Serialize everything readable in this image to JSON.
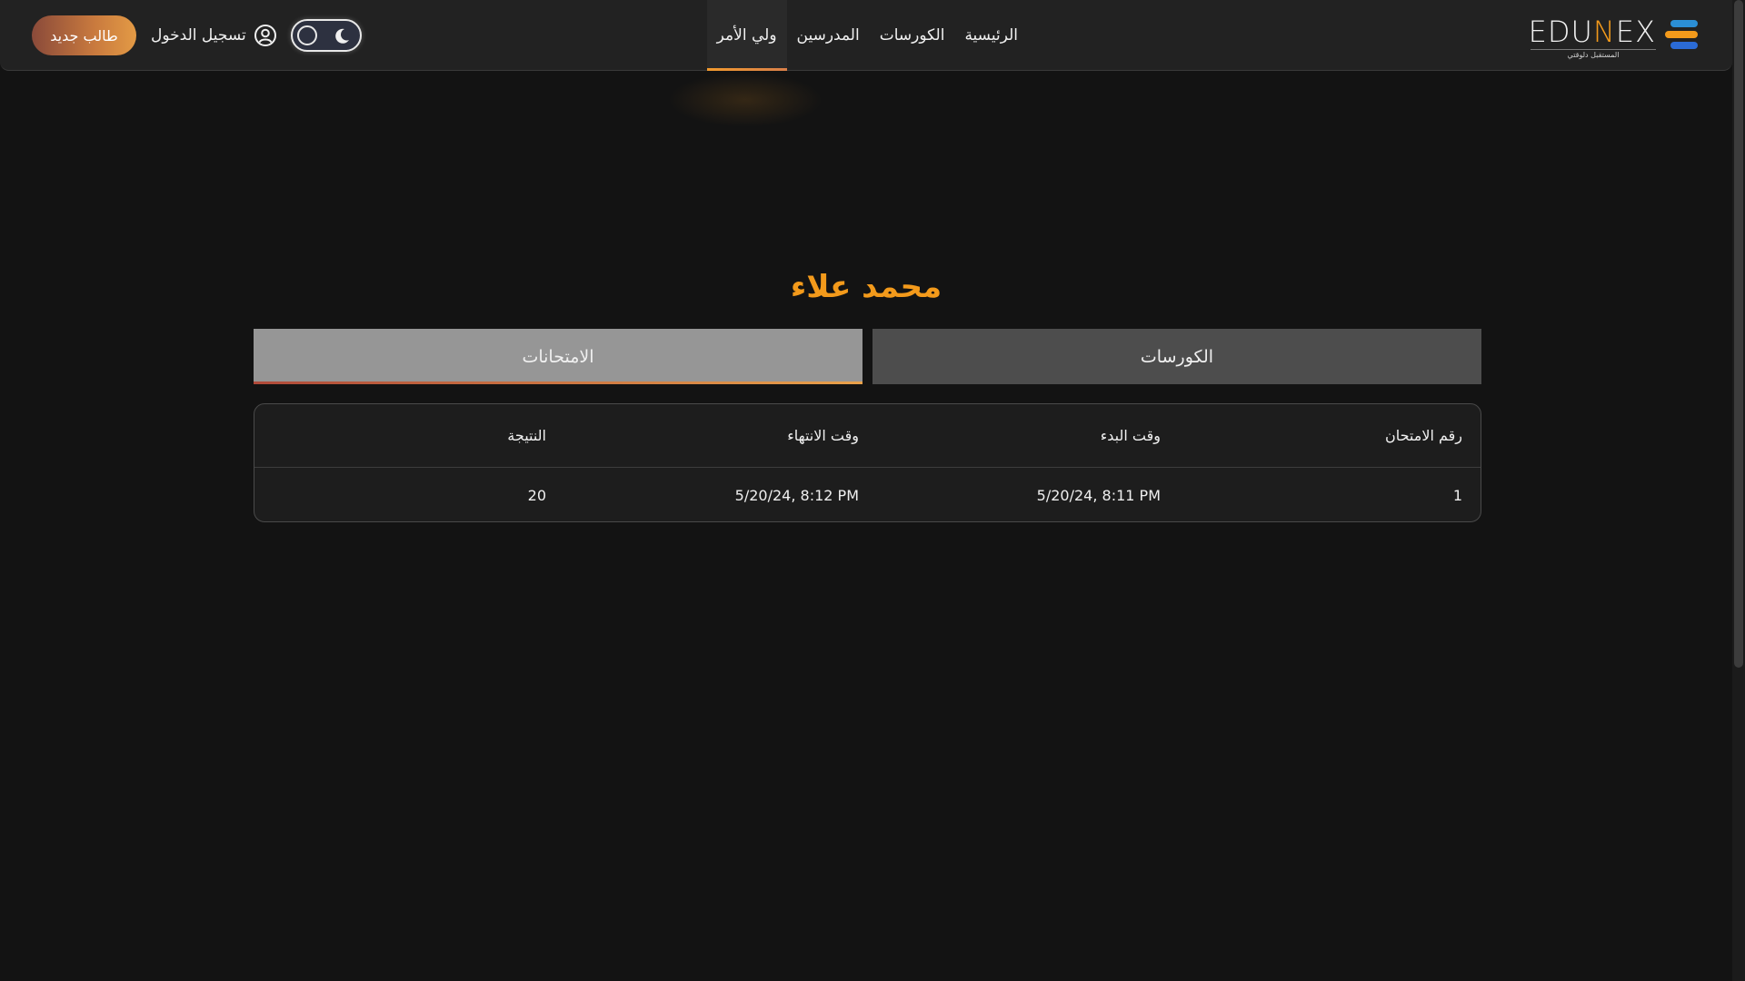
{
  "header": {
    "logo_word_left": "EDU",
    "logo_word_n": "N",
    "logo_word_right": "EX",
    "logo_tagline": "المستقبل دلوقتي",
    "nav": [
      {
        "label": "الرئيسية",
        "active": false
      },
      {
        "label": "الكورسات",
        "active": false
      },
      {
        "label": "المدرسين",
        "active": false
      },
      {
        "label": "ولي الأمر",
        "active": true
      }
    ],
    "login_label": "تسجيل الدخول",
    "signup_label": "طالب جديد",
    "theme": "dark"
  },
  "student": {
    "name": "محمد علاء"
  },
  "tabs": {
    "courses": "الكورسات",
    "exams": "الامتحانات",
    "active": "exams"
  },
  "table": {
    "headers": [
      "رقم الامتحان",
      "وقت البدء",
      "وقت الانتهاء",
      "النتيجة"
    ],
    "rows": [
      [
        "1",
        "5/20/24, 8:11 PM",
        "5/20/24, 8:12 PM",
        "20"
      ]
    ]
  },
  "colors": {
    "accent": "#f39a1b",
    "background": "#131313",
    "header": "#222222"
  }
}
